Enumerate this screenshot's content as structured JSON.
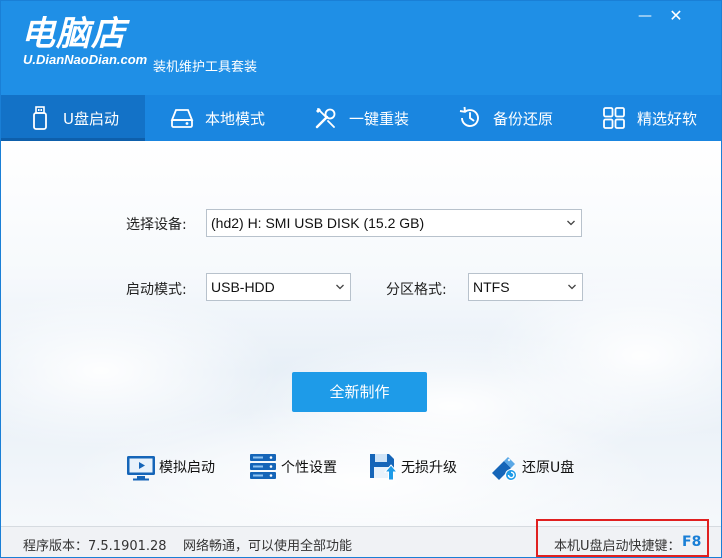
{
  "app": {
    "logo_main": "电脑店",
    "logo_sub": "U.DianNaoDian.com",
    "suite_title": "装机维护工具套装"
  },
  "window_controls": {
    "minimize": "—",
    "close": "✕"
  },
  "nav": {
    "items": [
      {
        "label": "U盘启动",
        "icon": "usb-drive-icon"
      },
      {
        "label": "本地模式",
        "icon": "hard-disk-icon"
      },
      {
        "label": "一键重装",
        "icon": "tools-icon"
      },
      {
        "label": "备份还原",
        "icon": "restore-icon"
      },
      {
        "label": "精选好软",
        "icon": "grid-icon"
      }
    ],
    "active_index": 0
  },
  "form": {
    "device_label": "选择设备:",
    "device_value": "(hd2) H: SMI USB DISK (15.2 GB)",
    "boot_mode_label": "启动模式:",
    "boot_mode_value": "USB-HDD",
    "partition_label": "分区格式:",
    "partition_value": "NTFS"
  },
  "primary_action": "全新制作",
  "tools": [
    {
      "label": "模拟启动",
      "icon": "monitor-icon"
    },
    {
      "label": "个性设置",
      "icon": "server-settings-icon"
    },
    {
      "label": "无损升级",
      "icon": "floppy-upgrade-icon"
    },
    {
      "label": "还原U盘",
      "icon": "usb-restore-icon"
    }
  ],
  "status": {
    "version": "程序版本：7.5.1901.28",
    "network": "网络畅通，可以使用全部功能",
    "hotkey_label": "本机U盘启动快捷键：",
    "hotkey_value": "F8"
  },
  "colors": {
    "header": "#1f8fe6",
    "nav": "#1a86e0",
    "nav_active": "#1372c7",
    "primary_button": "#1e9be8",
    "highlight_border": "#e02020",
    "hotkey": "#1a7fd6"
  }
}
